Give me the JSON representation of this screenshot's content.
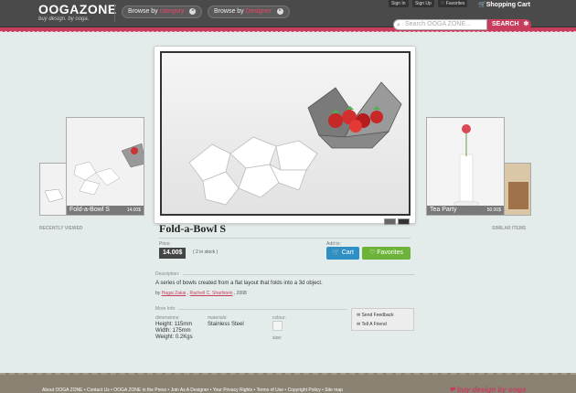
{
  "header": {
    "logo_text": "OOGAZONE",
    "logo_tag": "buy design. by ooga.",
    "browse1_prefix": "Browse by",
    "browse1_value": "category",
    "browse2_prefix": "Browse by",
    "browse2_value": "Designer",
    "sign_in": "Sign In",
    "sign_up": "Sign Up",
    "favorites": "Favorites",
    "shopping_cart": "Shopping Cart",
    "search_placeholder": "Search OOGA ZONE...",
    "search_button": "SEARCH"
  },
  "product": {
    "title": "Fold-a-Bowl S",
    "price_label": "Price:",
    "price": "14.00$",
    "stock": "( 2 in stock )",
    "add_to_label": "Add to:",
    "cart_button": "Cart",
    "favorites_button": "Favorites",
    "description_label": "Description:",
    "description": "A series of bowls created from a flat layout that folds into a 3d object.",
    "by_prefix": "by",
    "designer1": "Hagai Zakai",
    "designer2": "Rachell C. Sharfstein",
    "year": ", 2008",
    "more_info_label": "More Info:",
    "dimensions_label": "dimensions:",
    "dimensions": [
      "Height: 115mm",
      "Width: 175mm",
      "Weight: 0.2Kgs"
    ],
    "materials_label": "materials:",
    "materials": "Stainless Steel",
    "colour_label": "colour:",
    "size_label": "size:",
    "send_feedback": "Send Feedback",
    "tell_friend": "Tell A Friend"
  },
  "left_thumb": {
    "name": "Fold-a-Bowl S",
    "price": "14.00$",
    "caption": "RECENTLY VIEWED"
  },
  "right_thumb": {
    "name": "Tea Party",
    "price": "50.00$",
    "caption": "SIMILAR ITEMS"
  },
  "footer": {
    "links": "About OOGA ZONE  •  Contact Us  •  OOGA ZONE in the Press  •  Join As A Designer  •  Your Privacy Rights  •  Terms of Use  •  Copyright Policy  •  Site map",
    "logo": "buy design by ooga"
  },
  "colors": {
    "accent": "#c83c5c",
    "cart": "#2d8fc4",
    "favorites": "#6db33a"
  }
}
